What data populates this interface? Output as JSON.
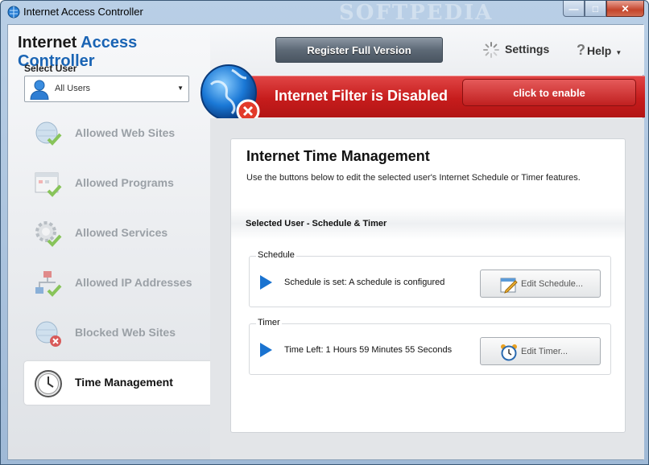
{
  "window": {
    "title": "Internet Access Controller",
    "watermark": "SOFTPEDIA"
  },
  "app": {
    "title_part1": "Internet ",
    "title_part2": "Access Controller"
  },
  "user_select": {
    "label": "Select User",
    "value": "All Users"
  },
  "nav": [
    {
      "label": "Allowed Web Sites",
      "icon": "globe-check-icon",
      "active": false
    },
    {
      "label": "Allowed Programs",
      "icon": "window-check-icon",
      "active": false
    },
    {
      "label": "Allowed Services",
      "icon": "gear-check-icon",
      "active": false
    },
    {
      "label": "Allowed IP Addresses",
      "icon": "network-check-icon",
      "active": false
    },
    {
      "label": "Blocked Web Sites",
      "icon": "globe-block-icon",
      "active": false
    },
    {
      "label": "Time Management",
      "icon": "clock-icon",
      "active": true
    }
  ],
  "toolbar": {
    "register": "Register Full Version",
    "settings": "Settings",
    "help": "Help"
  },
  "filter": {
    "status": "Internet Filter is Disabled",
    "enable": "click to enable",
    "color": "#c61c1c"
  },
  "main": {
    "title": "Internet Time Management",
    "description": "Use the buttons below to edit the selected user's Internet Schedule or Timer features.",
    "section": "Selected User - Schedule & Timer",
    "schedule": {
      "label": "Schedule",
      "status": "Schedule is set: A schedule is configured",
      "button": "Edit Schedule..."
    },
    "timer": {
      "label": "Timer",
      "status": "Time Left: 1 Hours 59 Minutes 55 Seconds",
      "button": "Edit Timer..."
    }
  }
}
